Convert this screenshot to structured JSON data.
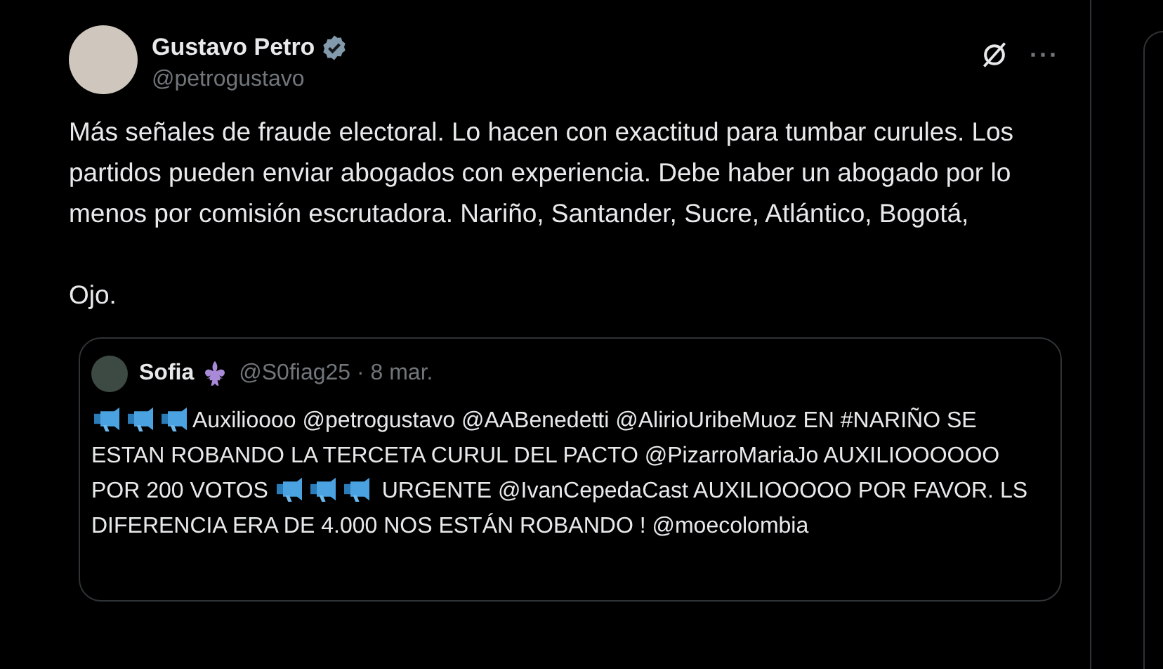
{
  "tweet": {
    "author": {
      "name": "Gustavo Petro",
      "handle": "@petrogustavo",
      "verified": true
    },
    "paragraphs": [
      "Más señales de fraude electoral. Lo hacen con exactitud para tumbar curules. Los partidos pueden enviar abogados con experiencia. Debe haber un abogado por lo menos por comisión escrutadora. Nariño, Santander, Sucre, Atlántico, Bogotá,",
      "Ojo."
    ],
    "more_button": "···",
    "quote": {
      "author": {
        "name": "Sofia",
        "handle": "@S0fiag25",
        "date": "· 8 mar."
      },
      "segments": [
        {
          "kind": "megaphone"
        },
        {
          "kind": "megaphone"
        },
        {
          "kind": "megaphone"
        },
        {
          "kind": "text",
          "text": "Auxilioooo @petrogustavo @AABenedetti @AlirioUribeMuoz EN #NARIÑO SE ESTAN ROBANDO LA TERCETA CURUL DEL PACTO @PizarroMariaJo AUXILIOOOOOO POR 200 VOTOS "
        },
        {
          "kind": "megaphone"
        },
        {
          "kind": "megaphone"
        },
        {
          "kind": "megaphone"
        },
        {
          "kind": "text",
          "text": " URGENTE @IvanCepedaCast AUXILIOOOOO POR FAVOR. LS DIFERENCIA ERA DE 4.000 NOS ESTÁN ROBANDO ! @moecolombia"
        }
      ]
    }
  }
}
